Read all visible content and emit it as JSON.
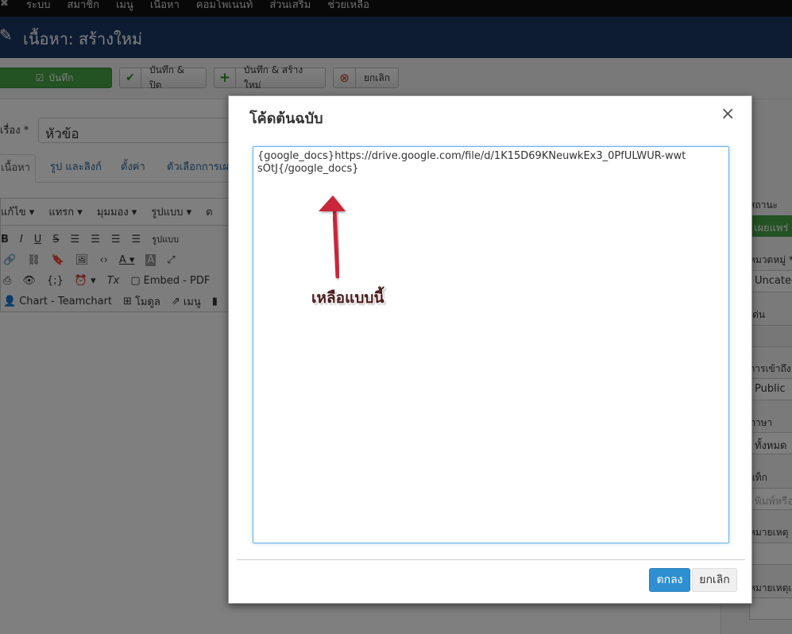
{
  "topbar": {
    "menu": [
      "ระบบ",
      "สมาชิก",
      "เมนู",
      "เนื้อหา",
      "คอมโพเนนท์",
      "ส่วนเสริม",
      "ช่วยเหลือ"
    ]
  },
  "header": {
    "title": "เนื้อหา: สร้างใหม่"
  },
  "toolbar": {
    "save_label": "บันทึก",
    "save_close_label": "บันทึก & ปิด",
    "save_new_label": "บันทึก & สร้างใหม่",
    "cancel_label": "ยกเลิก"
  },
  "form": {
    "title_label": "เรื่อง *",
    "title_value": "หัวข้อ",
    "tabs": [
      "เนื้อหา",
      "รูป และลิงก์",
      "ตั้งค่า",
      "ตัวเลือกการเผ"
    ]
  },
  "editor": {
    "menus": [
      "แก้ไข ▾",
      "แทรก ▾",
      "มุมมอง ▾",
      "รูปแบบ ▾",
      "ต"
    ],
    "format_label": "รูปแบบ",
    "embed_pdf": "Embed - PDF",
    "chart_teamchart": "Chart - Teamchart",
    "module": "โมดูล",
    "menu": "เมนู"
  },
  "sidebar": {
    "status_label": "สถานะ",
    "status_value": "เผยแพร่",
    "category_label": "หมวดหมู่ *",
    "category_value": "Uncategorised",
    "featured_label": "เด่น",
    "access_label": "การเข้าถึง",
    "access_value": "Public",
    "language_label": "ภาษา",
    "language_value": "ทั้งหมด",
    "tags_label": "แท็ก",
    "tags_placeholder": "พิมพ์หรือเลือก",
    "note_label": "หมายเหตุ",
    "version_note_label": "หมายเหตุเวอร์ชั่น"
  },
  "modal": {
    "title": "โค้ดต้นฉบับ",
    "close": "×",
    "code_value": "{google_docs}https://drive.google.com/file/d/1K15D69KNeuwkEx3_0PfULWUR-wwtsOtJ{/google_docs}",
    "ok_label": "ตกลง",
    "cancel_label": "ยกเลิก"
  },
  "annotation": {
    "text": "เหลือแบบนี้",
    "arrow_color": "#c8273a"
  }
}
